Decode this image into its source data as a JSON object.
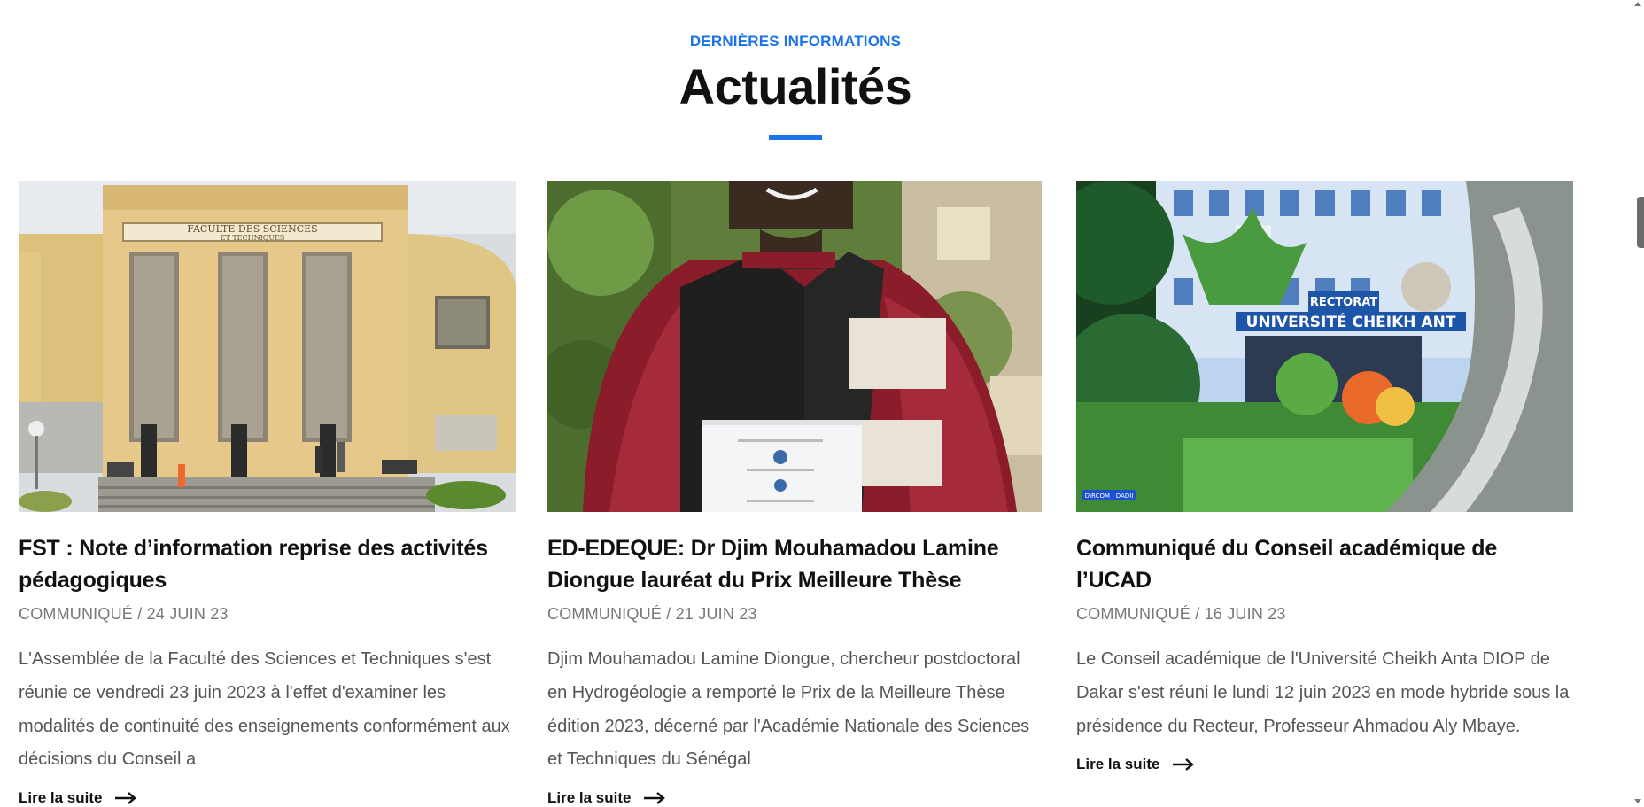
{
  "section": {
    "kicker": "DERNIÈRES INFORMATIONS",
    "title": "Actualités",
    "accent_color": "#1a73e8"
  },
  "cards": [
    {
      "title": "FST : Note d’information reprise des activités pédagogiques",
      "meta": "COMMUNIQUÉ / 24 JUIN 23",
      "excerpt": "L'Assemblée de la Faculté des Sciences et Techniques s'est réunie ce vendredi 23 juin 2023 à l'effet d'examiner les modalités de continuité des enseignements conformément aux décisions du Conseil a",
      "read_more": "Lire la suite",
      "image_sign_line1": "FACULTE DES SCIENCES",
      "image_sign_line2": "ET TECHNIQUES"
    },
    {
      "title": "ED-EDEQUE: Dr Djim Mouhamadou Lamine Diongue lauréat du Prix Meilleure Thèse",
      "meta": "COMMUNIQUÉ / 21 JUIN 23",
      "excerpt": "Djim Mouhamadou Lamine Diongue, chercheur postdoctoral en Hydrogéologie a remporté le Prix de la Meilleure Thèse édition 2023, décerné par l'Académie Nationale des Sciences et Techniques du Sénégal",
      "read_more": "Lire la suite"
    },
    {
      "title": "Communiqué du Conseil académique de l’UCAD",
      "meta": "COMMUNIQUÉ / 16 JUIN 23",
      "excerpt": "Le Conseil académique de l'Université Cheikh Anta DIOP de Dakar s'est réuni le lundi 12 juin 2023 en mode hybride sous la présidence du Recteur, Professeur Ahmadou Aly Mbaye.",
      "read_more": "Lire la suite",
      "image_sign_top": "RECTORAT",
      "image_sign_main": "UNIVERSITÉ CHEIKH ANT",
      "image_credit": "DIRCOM | DADII"
    }
  ]
}
